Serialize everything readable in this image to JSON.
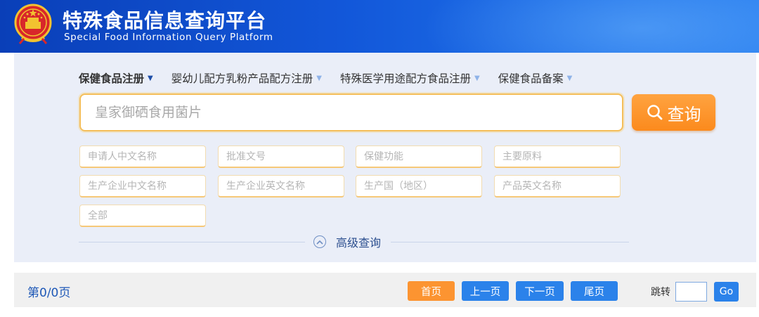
{
  "header": {
    "title_cn": "特殊食品信息查询平台",
    "title_en": "Special Food Information Query Platform",
    "emblem_icon": "national-emblem-icon"
  },
  "tabs": [
    {
      "label": "保健食品注册",
      "active": true
    },
    {
      "label": "婴幼儿配方乳粉产品配方注册",
      "active": false
    },
    {
      "label": "特殊医学用途配方食品注册",
      "active": false
    },
    {
      "label": "保健食品备案",
      "active": false
    }
  ],
  "search": {
    "placeholder": "皇家御硒食用菌片",
    "value": "",
    "button_label": "查询"
  },
  "fields": [
    {
      "placeholder": "申请人中文名称"
    },
    {
      "placeholder": "批准文号"
    },
    {
      "placeholder": "保健功能"
    },
    {
      "placeholder": "主要原料"
    },
    {
      "placeholder": "生产企业中文名称"
    },
    {
      "placeholder": "生产企业英文名称"
    },
    {
      "placeholder": "生产国（地区）"
    },
    {
      "placeholder": "产品英文名称"
    },
    {
      "placeholder": "全部"
    }
  ],
  "advanced": {
    "label": "高级查询"
  },
  "pager": {
    "info": "第0/0页",
    "first": "首页",
    "prev": "上一页",
    "next": "下一页",
    "last": "尾页",
    "jump_label": "跳转",
    "jump_value": "",
    "go": "Go"
  },
  "colors": {
    "header_blue": "#1257d9",
    "accent_orange": "#fb8a1d",
    "button_blue": "#2b82ea",
    "panel_bg": "#eaeef8"
  }
}
